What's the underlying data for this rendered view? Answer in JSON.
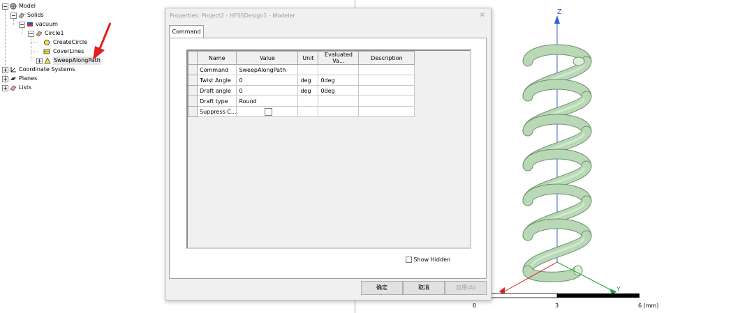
{
  "tree": {
    "model": "Model",
    "solids": "Solids",
    "vacuum": "vacuum",
    "circle1": "Circle1",
    "create_circle": "CreateCircle",
    "cover_lines": "CoverLines",
    "sweep_along_path": "SweepAlongPath",
    "coordinate_systems": "Coordinate Systems",
    "planes": "Planes",
    "lists": "Lists"
  },
  "dialog": {
    "title": "Properties: Project2 - HFSSDesign1 - Modeler",
    "close": "×",
    "tab": "Command",
    "columns": [
      "Name",
      "Value",
      "Unit",
      "Evaluated Va...",
      "Description"
    ],
    "rows": [
      {
        "name": "Command",
        "value": "SweepAlongPath",
        "unit": "",
        "evaluated": "",
        "description": ""
      },
      {
        "name": "Twist Angle",
        "value": "0",
        "unit": "deg",
        "evaluated": "0deg",
        "description": ""
      },
      {
        "name": "Draft angle",
        "value": "0",
        "unit": "deg",
        "evaluated": "0deg",
        "description": ""
      },
      {
        "name": "Draft type",
        "value": "Round",
        "unit": "",
        "evaluated": "",
        "description": ""
      },
      {
        "name": "Suppress C...",
        "value": "",
        "unit": "",
        "evaluated": "",
        "description": "",
        "checkbox": true
      }
    ],
    "show_hidden_label": "Show Hidden",
    "ok_label": "确定",
    "cancel_label": "取消",
    "apply_label": "应用(A)"
  },
  "viewport": {
    "axis_z": "Z",
    "axis_y": "Y",
    "scale_0": "0",
    "scale_3": "3",
    "scale_6": "6 (mm)",
    "helix_color": "#b9d9b6"
  }
}
